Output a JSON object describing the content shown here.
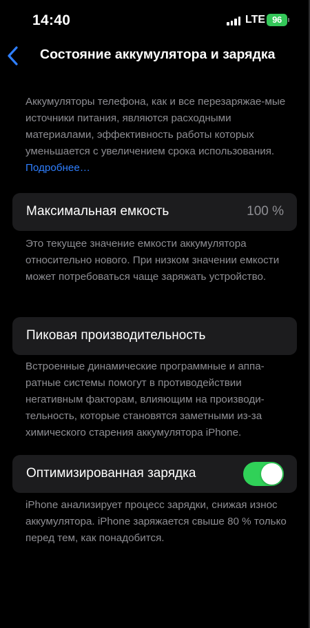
{
  "status_bar": {
    "time": "14:40",
    "network": "LTE",
    "battery": "96"
  },
  "nav": {
    "back_icon": "chevron-left-icon",
    "title": "Состояние аккумулятора и зарядка"
  },
  "intro": {
    "text": "Аккумуляторы телефона, как и все перезаряжае-мые источники питания, являются расходными материалами, эффективность работы которых уменьшается с увеличением срока использования.",
    "more_link": "Подробнее…"
  },
  "capacity": {
    "label": "Максимальная емкость",
    "value": "100 %",
    "footer": "Это текущее значение емкости аккумулятора относительно нового. При низком значении емкости может потребоваться чаще заряжать устройство."
  },
  "peak": {
    "label": "Пиковая производительность",
    "footer": "Встроенные динамические программные и аппа-ратные системы помогут в противодействии негативным факторам, влияющим на производи-тельность, которые становятся заметными из-за химического старения аккумулятора iPhone."
  },
  "optimized": {
    "label": "Оптимизированная зарядка",
    "enabled": true,
    "footer": "iPhone анализирует процесс зарядки, снижая износ аккумулятора. iPhone заряжается свыше 80 % только перед тем, как понадобится."
  },
  "colors": {
    "background": "#000000",
    "cell": "#1c1c1e",
    "accent": "#2f7fff",
    "toggle_on": "#30d158",
    "battery": "#34c759",
    "secondary_text": "#8e8e93"
  }
}
